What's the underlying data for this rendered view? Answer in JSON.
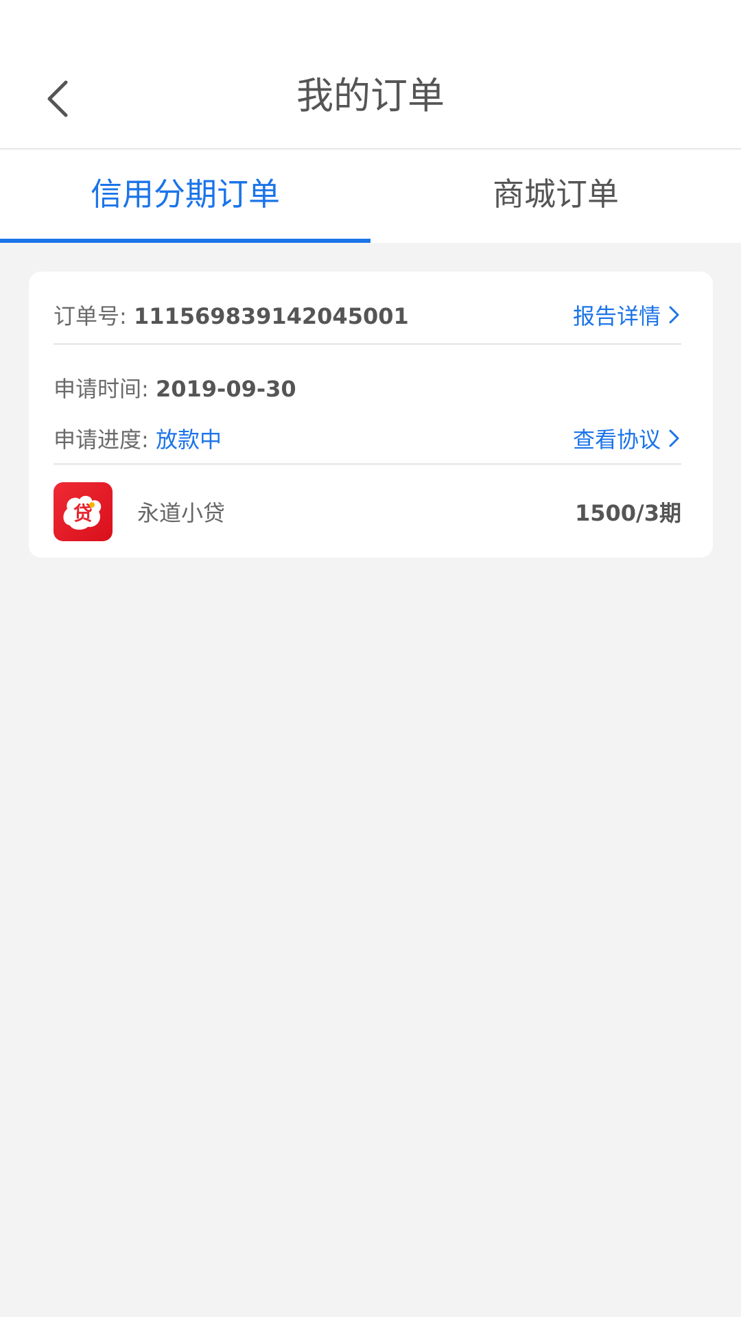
{
  "header": {
    "title": "我的订单",
    "back_icon": "chevron-left-icon"
  },
  "tabs": [
    {
      "label": "信用分期订单",
      "active": true
    },
    {
      "label": "商城订单",
      "active": false
    }
  ],
  "order": {
    "number_label": "订单号:",
    "number_value": "111569839142045001",
    "report_link": "报告详情",
    "apply_time_label": "申请时间:",
    "apply_time_value": "2019-09-30",
    "progress_label": "申请进度:",
    "progress_value": "放款中",
    "agreement_link": "查看协议",
    "product": {
      "logo_text": "贷",
      "name": "永道小贷",
      "amount": "1500/3期"
    }
  },
  "colors": {
    "accent": "#1b74e8",
    "background": "#f3f3f3",
    "logo_red": "#e52530"
  }
}
